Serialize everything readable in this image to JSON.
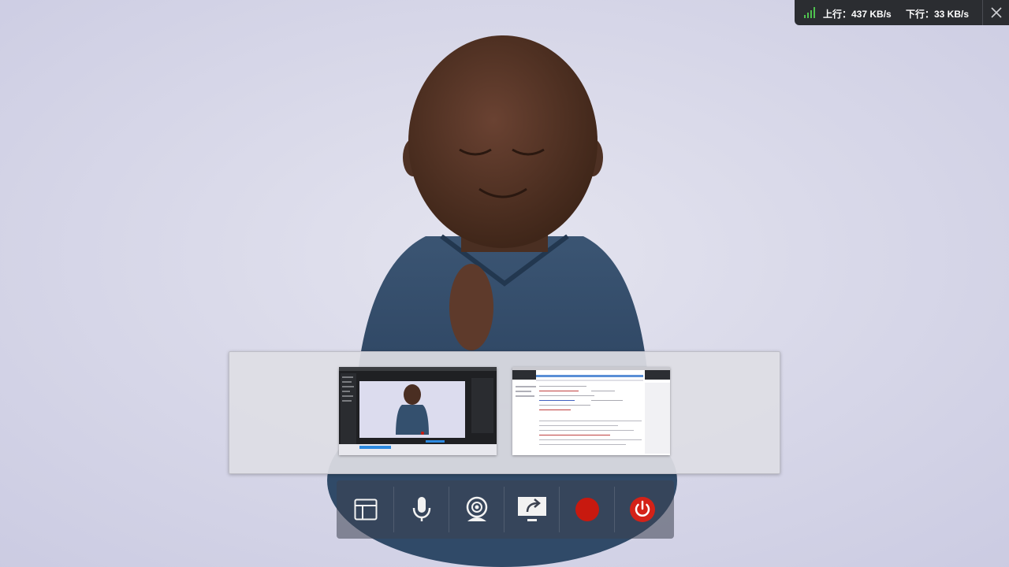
{
  "network": {
    "upload_text": "上行：437 KB/s",
    "download_text": "下行：33 KB/s",
    "signal_color": "#4fc24f",
    "close_icon": "close-icon"
  },
  "share_picker": {
    "options": [
      {
        "name": "screen-1",
        "kind": "desktop-with-video"
      },
      {
        "name": "screen-2",
        "kind": "document-window"
      }
    ]
  },
  "toolbar": {
    "buttons": [
      {
        "name": "layout-button",
        "icon": "layout-icon"
      },
      {
        "name": "microphone-button",
        "icon": "microphone-icon"
      },
      {
        "name": "camera-button",
        "icon": "webcam-icon"
      },
      {
        "name": "share-screen-button",
        "icon": "share-screen-icon"
      },
      {
        "name": "record-button",
        "icon": "record-icon"
      },
      {
        "name": "hangup-button",
        "icon": "power-icon"
      }
    ],
    "record_color": "#c8190f",
    "hangup_color": "#d42218"
  }
}
